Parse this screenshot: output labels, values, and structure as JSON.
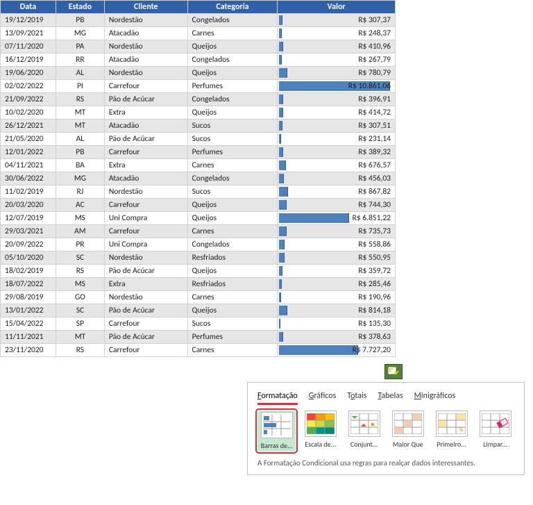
{
  "headers": {
    "data": "Data",
    "estado": "Estado",
    "cliente": "Cliente",
    "categoria": "Categoria",
    "valor": "Valor"
  },
  "max_valor": 10861.06,
  "rows": [
    {
      "data": "19/12/2019",
      "estado": "PB",
      "cliente": "Nordestão",
      "categoria": "Congelados",
      "valor": 307.37,
      "valor_disp": "R$ 307,37"
    },
    {
      "data": "13/09/2021",
      "estado": "MG",
      "cliente": "Atacadão",
      "categoria": "Carnes",
      "valor": 248.37,
      "valor_disp": "R$ 248,37"
    },
    {
      "data": "07/11/2020",
      "estado": "PA",
      "cliente": "Nordestão",
      "categoria": "Queijos",
      "valor": 410.96,
      "valor_disp": "R$ 410,96"
    },
    {
      "data": "16/12/2019",
      "estado": "RR",
      "cliente": "Atacadão",
      "categoria": "Congelados",
      "valor": 267.79,
      "valor_disp": "R$ 267,79"
    },
    {
      "data": "19/06/2020",
      "estado": "AL",
      "cliente": "Nordestão",
      "categoria": "Queijos",
      "valor": 780.79,
      "valor_disp": "R$ 780,79"
    },
    {
      "data": "02/02/2022",
      "estado": "PI",
      "cliente": "Carrefour",
      "categoria": "Perfumes",
      "valor": 10861.06,
      "valor_disp": "R$ 10.861,06"
    },
    {
      "data": "21/09/2022",
      "estado": "RS",
      "cliente": "Pão de Acúcar",
      "categoria": "Congelados",
      "valor": 396.91,
      "valor_disp": "R$ 396,91"
    },
    {
      "data": "10/02/2020",
      "estado": "MT",
      "cliente": "Extra",
      "categoria": "Queijos",
      "valor": 414.72,
      "valor_disp": "R$ 414,72"
    },
    {
      "data": "26/12/2021",
      "estado": "MT",
      "cliente": "Atacadão",
      "categoria": "Sucos",
      "valor": 307.51,
      "valor_disp": "R$ 307,51"
    },
    {
      "data": "21/05/2020",
      "estado": "AL",
      "cliente": "Pão de Acúcar",
      "categoria": "Sucos",
      "valor": 231.14,
      "valor_disp": "R$ 231,14"
    },
    {
      "data": "12/01/2022",
      "estado": "PB",
      "cliente": "Carrefour",
      "categoria": "Perfumes",
      "valor": 389.32,
      "valor_disp": "R$ 389,32"
    },
    {
      "data": "04/11/2021",
      "estado": "BA",
      "cliente": "Extra",
      "categoria": "Carnes",
      "valor": 676.57,
      "valor_disp": "R$ 676,57"
    },
    {
      "data": "30/06/2022",
      "estado": "MG",
      "cliente": "Atacadão",
      "categoria": "Congelados",
      "valor": 456.03,
      "valor_disp": "R$ 456,03"
    },
    {
      "data": "11/02/2019",
      "estado": "RJ",
      "cliente": "Nordestão",
      "categoria": "Sucos",
      "valor": 867.82,
      "valor_disp": "R$ 867,82"
    },
    {
      "data": "20/03/2020",
      "estado": "AC",
      "cliente": "Carrefour",
      "categoria": "Queijos",
      "valor": 744.3,
      "valor_disp": "R$ 744,30"
    },
    {
      "data": "12/07/2019",
      "estado": "MS",
      "cliente": "Uni Compra",
      "categoria": "Queijos",
      "valor": 6851.22,
      "valor_disp": "R$ 6.851,22"
    },
    {
      "data": "29/03/2021",
      "estado": "AM",
      "cliente": "Carrefour",
      "categoria": "Carnes",
      "valor": 735.73,
      "valor_disp": "R$ 735,73"
    },
    {
      "data": "20/09/2022",
      "estado": "PR",
      "cliente": "Uni Compra",
      "categoria": "Congelados",
      "valor": 558.86,
      "valor_disp": "R$ 558,86"
    },
    {
      "data": "05/10/2020",
      "estado": "SC",
      "cliente": "Nordestão",
      "categoria": "Resfriados",
      "valor": 550.95,
      "valor_disp": "R$ 550,95"
    },
    {
      "data": "18/02/2019",
      "estado": "RS",
      "cliente": "Pão de Acúcar",
      "categoria": "Queijos",
      "valor": 359.72,
      "valor_disp": "R$ 359,72"
    },
    {
      "data": "18/07/2022",
      "estado": "MS",
      "cliente": "Extra",
      "categoria": "Resfriados",
      "valor": 285.46,
      "valor_disp": "R$ 285,46"
    },
    {
      "data": "29/08/2019",
      "estado": "GO",
      "cliente": "Nordestão",
      "categoria": "Carnes",
      "valor": 190.96,
      "valor_disp": "R$ 190,96"
    },
    {
      "data": "13/01/2022",
      "estado": "SC",
      "cliente": "Pão de Acúcar",
      "categoria": "Queijos",
      "valor": 814.18,
      "valor_disp": "R$ 814,18"
    },
    {
      "data": "15/04/2022",
      "estado": "SP",
      "cliente": "Carrefour",
      "categoria": "Sucos",
      "valor": 135.3,
      "valor_disp": "R$ 135,30"
    },
    {
      "data": "11/11/2021",
      "estado": "MT",
      "cliente": "Pão de Acúcar",
      "categoria": "Perfumes",
      "valor": 378.63,
      "valor_disp": "R$ 378,63"
    },
    {
      "data": "23/11/2020",
      "estado": "RS",
      "cliente": "Carrefour",
      "categoria": "Carnes",
      "valor": 7727.2,
      "valor_disp": "R$ 7.727,20"
    }
  ],
  "quick_analysis": {
    "tabs": [
      {
        "label": "Formatação",
        "u": "F",
        "active": true
      },
      {
        "label": "Gráficos",
        "u": "G",
        "active": false
      },
      {
        "label": "Totais",
        "u": "o",
        "active": false
      },
      {
        "label": "Tabelas",
        "u": "T",
        "active": false
      },
      {
        "label": "Minigráficos",
        "u": "M",
        "active": false
      }
    ],
    "options": [
      {
        "label": "Barras de...",
        "selected": true
      },
      {
        "label": "Escala de...",
        "selected": false
      },
      {
        "label": "Conjunt...",
        "selected": false
      },
      {
        "label": "Maior Que",
        "selected": false
      },
      {
        "label": "Primeiro...",
        "selected": false
      },
      {
        "label": "Limpar...",
        "selected": false
      }
    ],
    "hint": "A Formatação Condicional usa regras para realçar dados interessantes."
  }
}
